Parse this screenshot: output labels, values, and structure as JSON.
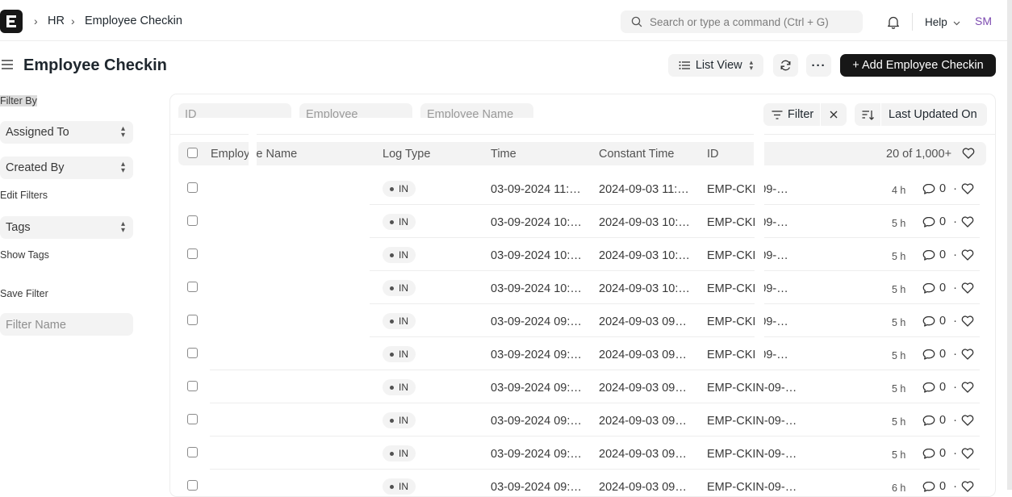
{
  "topbar": {
    "breadcrumbs": [
      "HR",
      "Employee Checkin"
    ],
    "search_placeholder": "Search or type a command (Ctrl + G)",
    "help_label": "Help",
    "user_initials": "SM"
  },
  "page": {
    "title": "Employee Checkin",
    "list_view_label": "List View",
    "add_button_label": "+ Add Employee Checkin"
  },
  "sidebar": {
    "filter_by_label": "Filter By",
    "assigned_to_label": "Assigned To",
    "created_by_label": "Created By",
    "edit_filters_label": "Edit Filters",
    "tags_label": "Tags",
    "show_tags_label": "Show Tags",
    "save_filter_label": "Save Filter",
    "filter_name_placeholder": "Filter Name"
  },
  "filters": {
    "id_placeholder": "ID",
    "employee_placeholder": "Employee",
    "employee_name_placeholder": "Employee Name",
    "filter_label": "Filter",
    "sort_label": "Last Updated On"
  },
  "table": {
    "columns": [
      "Employee Name",
      "Log Type",
      "Time",
      "Constant Time",
      "ID"
    ],
    "count_label": "20 of 1,000+",
    "rows": [
      {
        "log_type": "IN",
        "time": "03-09-2024 11:…",
        "constant_time": "2024-09-03 11:…",
        "id_prefix": "EMP-CKI",
        "id_suffix": "-09-…",
        "ago": "4 h",
        "comments": "0"
      },
      {
        "log_type": "IN",
        "time": "03-09-2024 10:…",
        "constant_time": "2024-09-03 10:…",
        "id_prefix": "EMP-CKI",
        "id_suffix": "-09-…",
        "ago": "5 h",
        "comments": "0"
      },
      {
        "log_type": "IN",
        "time": "03-09-2024 10:…",
        "constant_time": "2024-09-03 10:…",
        "id_prefix": "EMP-CKI",
        "id_suffix": "-09-…",
        "ago": "5 h",
        "comments": "0"
      },
      {
        "log_type": "IN",
        "time": "03-09-2024 10:…",
        "constant_time": "2024-09-03 10:…",
        "id_prefix": "EMP-CKI",
        "id_suffix": "-09-…",
        "ago": "5 h",
        "comments": "0"
      },
      {
        "log_type": "IN",
        "time": "03-09-2024 09:…",
        "constant_time": "2024-09-03 09…",
        "id_prefix": "EMP-CKI",
        "id_suffix": "-09-…",
        "ago": "5 h",
        "comments": "0"
      },
      {
        "log_type": "IN",
        "time": "03-09-2024 09:…",
        "constant_time": "2024-09-03 09…",
        "id_prefix": "EMP-CKI",
        "id_suffix": "-09-…",
        "ago": "5 h",
        "comments": "0"
      },
      {
        "log_type": "IN",
        "time": "03-09-2024 09:…",
        "constant_time": "2024-09-03 09…",
        "id_prefix": "EMP-CKIN",
        "id_suffix": "-09-…",
        "ago": "5 h",
        "comments": "0"
      },
      {
        "log_type": "IN",
        "time": "03-09-2024 09:…",
        "constant_time": "2024-09-03 09…",
        "id_prefix": "EMP-CKIN",
        "id_suffix": "-09-…",
        "ago": "5 h",
        "comments": "0"
      },
      {
        "log_type": "IN",
        "time": "03-09-2024 09:…",
        "constant_time": "2024-09-03 09…",
        "id_prefix": "EMP-CKIN",
        "id_suffix": "-09-…",
        "ago": "5 h",
        "comments": "0"
      },
      {
        "log_type": "IN",
        "time": "03-09-2024 09:…",
        "constant_time": "2024-09-03 09…",
        "id_prefix": "EMP-CKIN",
        "id_suffix": "-09-…",
        "ago": "6 h",
        "comments": "0"
      }
    ]
  }
}
